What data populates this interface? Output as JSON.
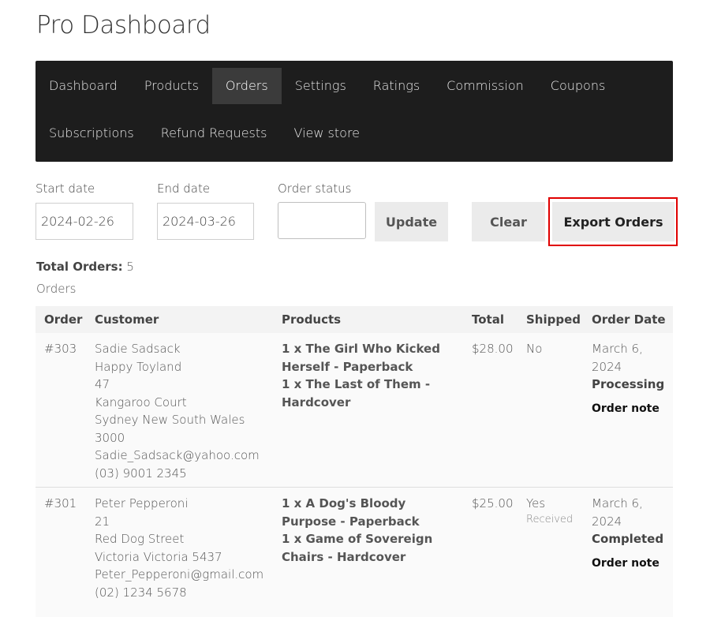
{
  "page": {
    "title": "Pro Dashboard"
  },
  "nav": {
    "row1": [
      "Dashboard",
      "Products",
      "Orders",
      "Settings",
      "Ratings",
      "Commission",
      "Coupons"
    ],
    "row2": [
      "Subscriptions",
      "Refund Requests",
      "View store"
    ],
    "active": "Orders"
  },
  "filters": {
    "start_label": "Start date",
    "start_value": "2024-02-26",
    "end_label": "End date",
    "end_value": "2024-03-26",
    "status_label": "Order status",
    "status_value": ""
  },
  "buttons": {
    "update": "Update",
    "clear": "Clear",
    "export": "Export Orders"
  },
  "summary": {
    "total_label": "Total Orders:",
    "total_value": "5",
    "caption": "Orders"
  },
  "table": {
    "headers": [
      "Order",
      "Customer",
      "Products",
      "Total",
      "Shipped",
      "Order Date"
    ],
    "rows": [
      {
        "order": "#303",
        "customer": [
          "Sadie Sadsack",
          "Happy Toyland",
          "47",
          "Kangaroo Court",
          "Sydney New South Wales",
          "3000",
          "Sadie_Sadsack@yahoo.com",
          "(03) 9001 2345"
        ],
        "products": [
          "1 x The Girl Who Kicked Herself - Paperback",
          "1 x The Last of Them - Hardcover"
        ],
        "total": "$28.00",
        "shipped": "No",
        "shipped_note": "",
        "date": "March 6, 2024",
        "status": "Processing",
        "note": "Order note"
      },
      {
        "order": "#301",
        "customer": [
          "Peter Pepperoni",
          "21",
          "Red Dog Street",
          "Victoria Victoria 5437",
          "Peter_Pepperoni@gmail.com",
          "(02) 1234 5678"
        ],
        "products": [
          "1 x A Dog's Bloody Purpose - Paperback",
          "1 x Game of Sovereign Chairs - Hardcover"
        ],
        "total": "$25.00",
        "shipped": "Yes",
        "shipped_note": "Received",
        "date": "March 6, 2024",
        "status": "Completed",
        "note": "Order note"
      }
    ]
  },
  "colors": {
    "nav_bg": "#1d1d1d",
    "nav_active": "#3b3b3b",
    "highlight": "#e00000"
  }
}
